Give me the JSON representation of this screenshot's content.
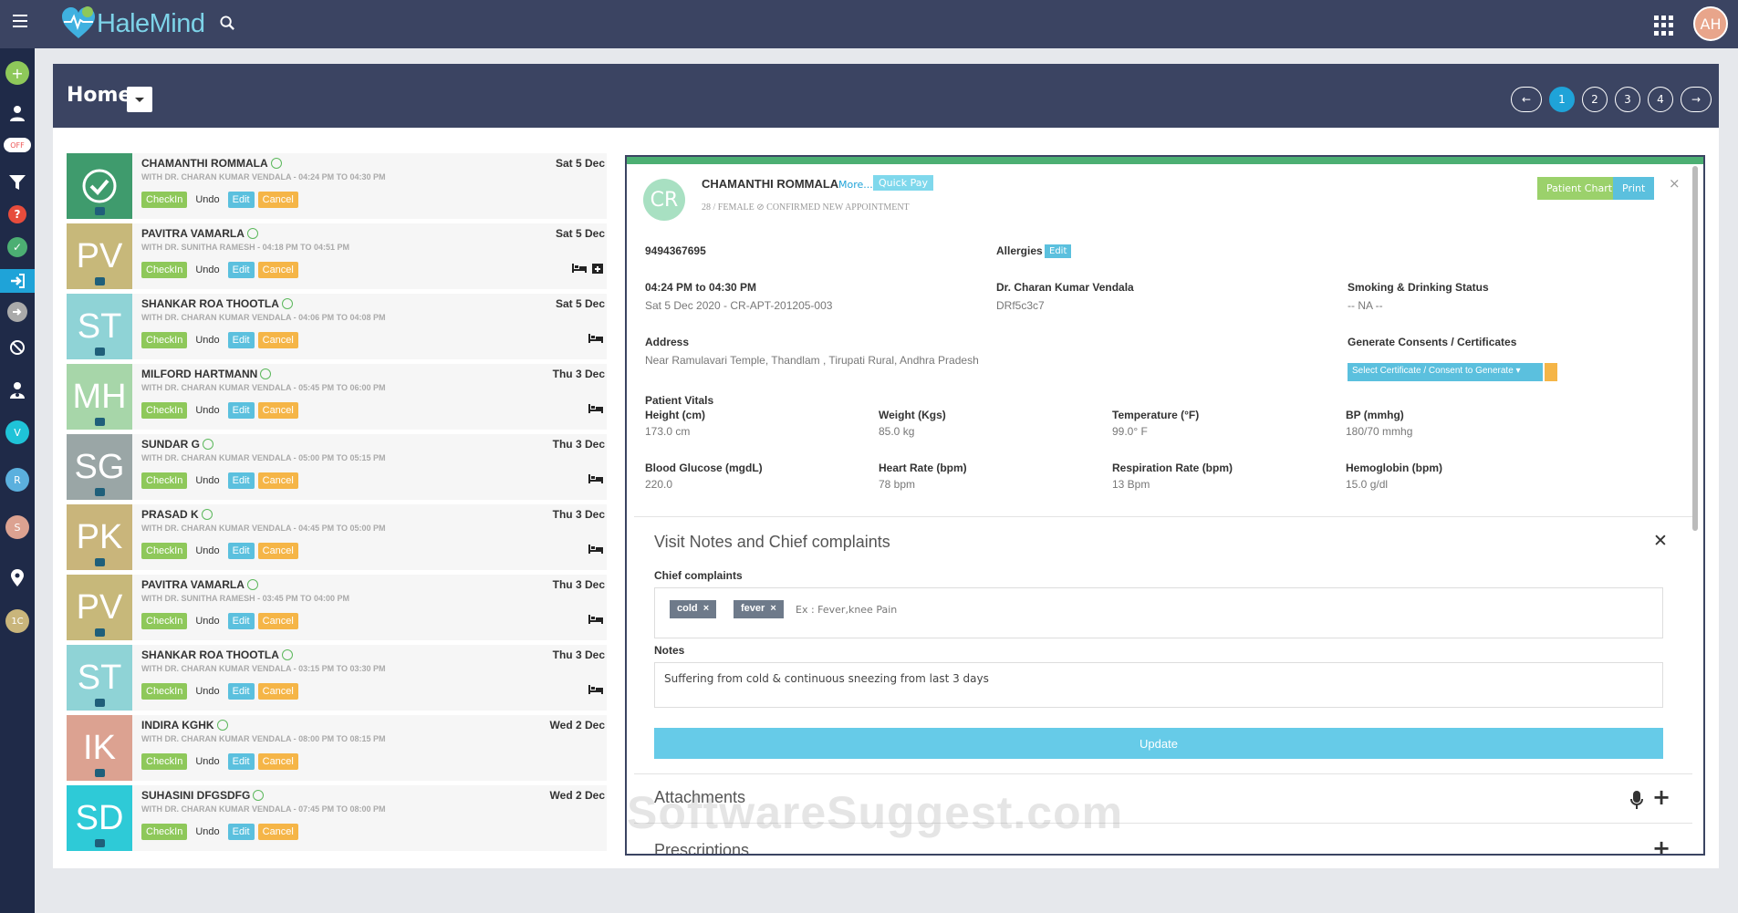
{
  "app": {
    "logo": "HaleMind",
    "user_initials": "AH"
  },
  "header": {
    "title": "Home"
  },
  "pagination": {
    "prev": "←",
    "pages": [
      "1",
      "2",
      "3",
      "4"
    ],
    "next": "→",
    "active": "1"
  },
  "appointments": [
    {
      "name": "CHAMANTHI ROMMALA",
      "with": "WITH DR. CHARAN KUMAR VENDALA - 04:24 PM TO 04:30 PM",
      "date": "Sat 5 Dec",
      "initials": "",
      "color": "#3f9b6d",
      "icon": "check"
    },
    {
      "name": "PAVITRA VAMARLA",
      "with": "WITH DR. SUNITHA RAMESH - 04:18 PM TO 04:51 PM",
      "date": "Sat 5 Dec",
      "initials": "PV",
      "color": "#c7b87a",
      "icon": "bed-plus"
    },
    {
      "name": "SHANKAR ROA THOOTLA",
      "with": "WITH DR. CHARAN KUMAR VENDALA - 04:06 PM TO 04:08 PM",
      "date": "Sat 5 Dec",
      "initials": "ST",
      "color": "#8fd3d6",
      "icon": "bed"
    },
    {
      "name": "MILFORD HARTMANN",
      "with": "WITH DR. CHARAN KUMAR VENDALA - 05:45 PM TO 06:00 PM",
      "date": "Thu 3 Dec",
      "initials": "MH",
      "color": "#a7d6a9",
      "icon": "bed"
    },
    {
      "name": "SUNDAR G",
      "with": "WITH DR. CHARAN KUMAR VENDALA - 05:00 PM TO 05:15 PM",
      "date": "Thu 3 Dec",
      "initials": "SG",
      "color": "#9aa6a6",
      "icon": "bed"
    },
    {
      "name": "PRASAD K",
      "with": "WITH DR. CHARAN KUMAR VENDALA - 04:45 PM TO 05:00 PM",
      "date": "Thu 3 Dec",
      "initials": "PK",
      "color": "#c9b57b",
      "icon": "bed"
    },
    {
      "name": "PAVITRA VAMARLA",
      "with": "WITH DR. SUNITHA RAMESH - 03:45 PM TO 04:00 PM",
      "date": "Thu 3 Dec",
      "initials": "PV",
      "color": "#c7b87a",
      "icon": "bed"
    },
    {
      "name": "SHANKAR ROA THOOTLA",
      "with": "WITH DR. CHARAN KUMAR VENDALA - 03:15 PM TO 03:30 PM",
      "date": "Thu 3 Dec",
      "initials": "ST",
      "color": "#8fd3d6",
      "icon": "bed"
    },
    {
      "name": "INDIRA KGHK",
      "with": "WITH DR. CHARAN KUMAR VENDALA - 08:00 PM TO 08:15 PM",
      "date": "Wed 2 Dec",
      "initials": "IK",
      "color": "#dca291",
      "icon": ""
    },
    {
      "name": "SUHASINI DFGSDFG",
      "with": "WITH DR. CHARAN KUMAR VENDALA - 07:45 PM TO 08:00 PM",
      "date": "Wed 2 Dec",
      "initials": "SD",
      "color": "#2ecad7",
      "icon": ""
    }
  ],
  "row_buttons": {
    "checkin": "CheckIn",
    "undo": "Undo",
    "edit": "Edit",
    "cancel": "Cancel"
  },
  "patient": {
    "initials": "CR",
    "name": "CHAMANTHI ROMMALA",
    "more": "More...",
    "quick_pay": "Quick Pay",
    "sub": "28 / FEMALE ⊘ CONFIRMED NEW APPOINTMENT",
    "patient_chart": "Patient Chart",
    "print": "Print",
    "close": "×",
    "phone": "9494367695",
    "allergies_label": "Allergies",
    "allergies_edit": "Edit",
    "time": "04:24 PM to 04:30 PM",
    "appt_ref": "Sat 5 Dec 2020 - CR-APT-201205-003",
    "doctor": "Dr. Charan Kumar Vendala",
    "doctor_id": "DRf5c3c7",
    "smoking_label": "Smoking & Drinking Status",
    "smoking_val": "-- NA --",
    "address_label": "Address",
    "address_val": "Near Ramulavari Temple, Thandlam , Tirupati Rural, Andhra Pradesh",
    "consents_label": "Generate Consents / Certificates",
    "consents_select": "Select Certificate / Consent to Generate ▾",
    "vitals_title": "Patient Vitals",
    "vitals": [
      {
        "label": "Height (cm)",
        "value": "173.0 cm"
      },
      {
        "label": "Weight (Kgs)",
        "value": "85.0 kg"
      },
      {
        "label": "Temperature (°F)",
        "value": "99.0° F"
      },
      {
        "label": "BP (mmhg)",
        "value": "180/70 mmhg"
      },
      {
        "label": "Blood Glucose (mgdL)",
        "value": "220.0"
      },
      {
        "label": "Heart Rate (bpm)",
        "value": "78 bpm"
      },
      {
        "label": "Respiration Rate (bpm)",
        "value": "13 Bpm"
      },
      {
        "label": "Hemoglobin (bpm)",
        "value": "15.0 g/dl"
      }
    ]
  },
  "visit": {
    "title": "Visit Notes and Chief complaints",
    "close": "✕",
    "complaints_label": "Chief complaints",
    "tags": [
      "cold",
      "fever"
    ],
    "tag_x": "×",
    "complaints_placeholder": "Ex : Fever,knee Pain",
    "notes_label": "Notes",
    "notes_value": "Suffering from cold & continuous sneezing from last 3 days",
    "update": "Update"
  },
  "attachments": {
    "title": "Attachments",
    "add": "+"
  },
  "prescriptions": {
    "title": "Prescriptions",
    "add": "+"
  },
  "watermark": "SoftwareSuggest.com"
}
